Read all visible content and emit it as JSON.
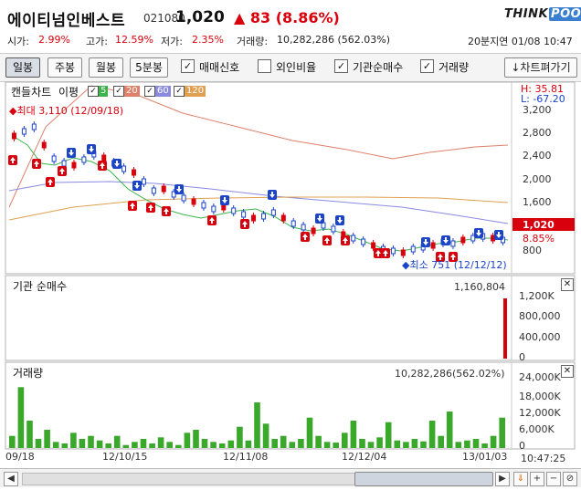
{
  "header": {
    "stock_name": "에이티넘인베스트",
    "stock_code": "021080",
    "price": "1,020",
    "change_arrow": "▲",
    "change": "83 (8.86%)",
    "logo_think": "THINK",
    "logo_pool": "POOL",
    "stats": {
      "open_label": "시가:",
      "open_value": "2.99%",
      "high_label": "고가:",
      "high_value": "12.59%",
      "low_label": "저가:",
      "low_value": "2.35%",
      "volume_label": "거래량:",
      "volume_value": "10,282,286 (562.03%)"
    },
    "time_info": "20분지연  01/08 10:47"
  },
  "toolbar": {
    "period_buttons": [
      "일봉",
      "주봉",
      "월봉",
      "5분봉"
    ],
    "active_period": "일봉",
    "checks": [
      {
        "label": "매매신호",
        "checked": true
      },
      {
        "label": "외인비율",
        "checked": false
      },
      {
        "label": "기관순매수",
        "checked": true
      },
      {
        "label": "거래량",
        "checked": true
      }
    ],
    "pivot_label": "↓차트펴가기"
  },
  "price_panel": {
    "title": "캔들차트",
    "type_label": "이평",
    "ma_legend": [
      {
        "label": "5",
        "color": "#3cb44b",
        "checked": true
      },
      {
        "label": "20",
        "color": "#e0806a",
        "checked": true
      },
      {
        "label": "60",
        "color": "#8a8ae0",
        "checked": true
      },
      {
        "label": "120",
        "color": "#e0a050",
        "checked": true
      }
    ],
    "max_label": "최대 3,110 (12/09/18)",
    "min_label": "최소 751 (12/12/12)",
    "h_label": "H: 35.81",
    "l_label": "L: -67.20",
    "current_price_tag": "1,020",
    "current_change_tag": "8.85%",
    "y_ticks": [
      "3,200",
      "2,800",
      "2,400",
      "2,000",
      "1,600",
      "800"
    ],
    "colors": {
      "up": "#d8000c",
      "down": "#1b44c8",
      "price_tag_bg": "#d8000c"
    }
  },
  "institution_panel": {
    "title": "기관 순매수",
    "value": "1,160,804",
    "y_ticks": [
      "1,200K",
      "800,000",
      "400,000",
      "0"
    ]
  },
  "volume_panel": {
    "title": "거래량",
    "value": "10,282,286(562.02%)",
    "y_ticks": [
      "24,000K",
      "18,000K",
      "12,000K",
      "6,000K",
      "0"
    ],
    "bar_color": "#3aa82a"
  },
  "x_axis": {
    "labels": [
      "09/18",
      "12/10/15",
      "12/11/08",
      "12/12/04",
      "13/01/03"
    ],
    "time": "10:47:25"
  },
  "chart_data": {
    "type": "bar",
    "title": "거래량",
    "xlabel": "",
    "ylabel": "",
    "ylim": [
      0,
      24000000
    ],
    "categories": [
      "09/18",
      "12/10/15",
      "12/11/08",
      "12/12/04",
      "13/01/03"
    ],
    "values": [
      4000000,
      20000000,
      9000000,
      3000000,
      6000000,
      2000000,
      1500000,
      5000000,
      3000000,
      4000000,
      2500000,
      1500000,
      4000000,
      1000000,
      2000000,
      3000000,
      1500000,
      3500000,
      2000000,
      1000000,
      5000000,
      6000000,
      3000000,
      2000000,
      1500000,
      2500000,
      7000000,
      2500000,
      15000000,
      8000000,
      3000000,
      4000000,
      2000000,
      3000000,
      10000000,
      4000000,
      2000000,
      1800000,
      5000000,
      9000000,
      3000000,
      2000000,
      3500000,
      8500000,
      2500000,
      2000000,
      3000000,
      2200000,
      9000000,
      4000000,
      12000000,
      2000000,
      2500000,
      3000000,
      1500000,
      4000000,
      10000000
    ]
  }
}
